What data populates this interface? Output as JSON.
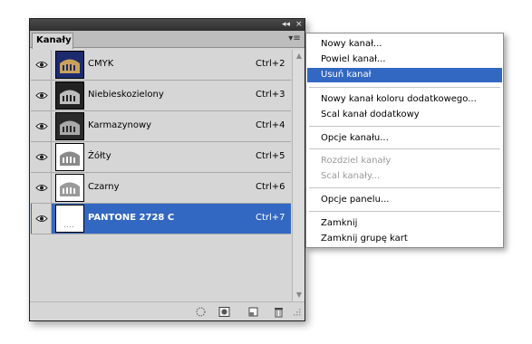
{
  "panel": {
    "tab_label": "Kanały",
    "collapse_glyph": "◂◂",
    "close_glyph": "×",
    "menu_glyph": "▾≡",
    "channels": [
      {
        "name": "CMYK",
        "shortcut": "Ctrl+2",
        "thumb": "colosseum-dark"
      },
      {
        "name": "Niebieskozielony",
        "shortcut": "Ctrl+3",
        "thumb": "colosseum-dark"
      },
      {
        "name": "Karmazynowy",
        "shortcut": "Ctrl+4",
        "thumb": "colosseum-dark"
      },
      {
        "name": "Żółty",
        "shortcut": "Ctrl+5",
        "thumb": "colosseum-light"
      },
      {
        "name": "Czarny",
        "shortcut": "Ctrl+6",
        "thumb": "colosseum-light"
      },
      {
        "name": "PANTONE 2728 C",
        "shortcut": "Ctrl+7",
        "thumb": "blank",
        "selected": true
      }
    ],
    "bottom_icons": [
      "load-selection-icon",
      "save-selection-icon",
      "new-channel-icon",
      "trash-icon"
    ]
  },
  "menu": {
    "items": [
      {
        "label": "Nowy kanał...",
        "state": "normal"
      },
      {
        "label": "Powiel kanał...",
        "state": "normal"
      },
      {
        "label": "Usuń kanał",
        "state": "highlighted"
      },
      {
        "label": "Nowy kanał koloru dodatkowego...",
        "state": "normal"
      },
      {
        "label": "Scal kanał dodatkowy",
        "state": "normal"
      },
      {
        "label": "Opcje kanału...",
        "state": "normal"
      },
      {
        "label": "Rozdziel kanały",
        "state": "disabled"
      },
      {
        "label": "Scal kanały...",
        "state": "disabled"
      },
      {
        "label": "Opcje panelu...",
        "state": "normal"
      },
      {
        "label": "Zamknij",
        "state": "normal"
      },
      {
        "label": "Zamknij grupę kart",
        "state": "normal"
      }
    ]
  },
  "colors": {
    "selection": "#3368c2",
    "panel_bg": "#d6d6d6",
    "titlebar": "#3a3a3a"
  }
}
